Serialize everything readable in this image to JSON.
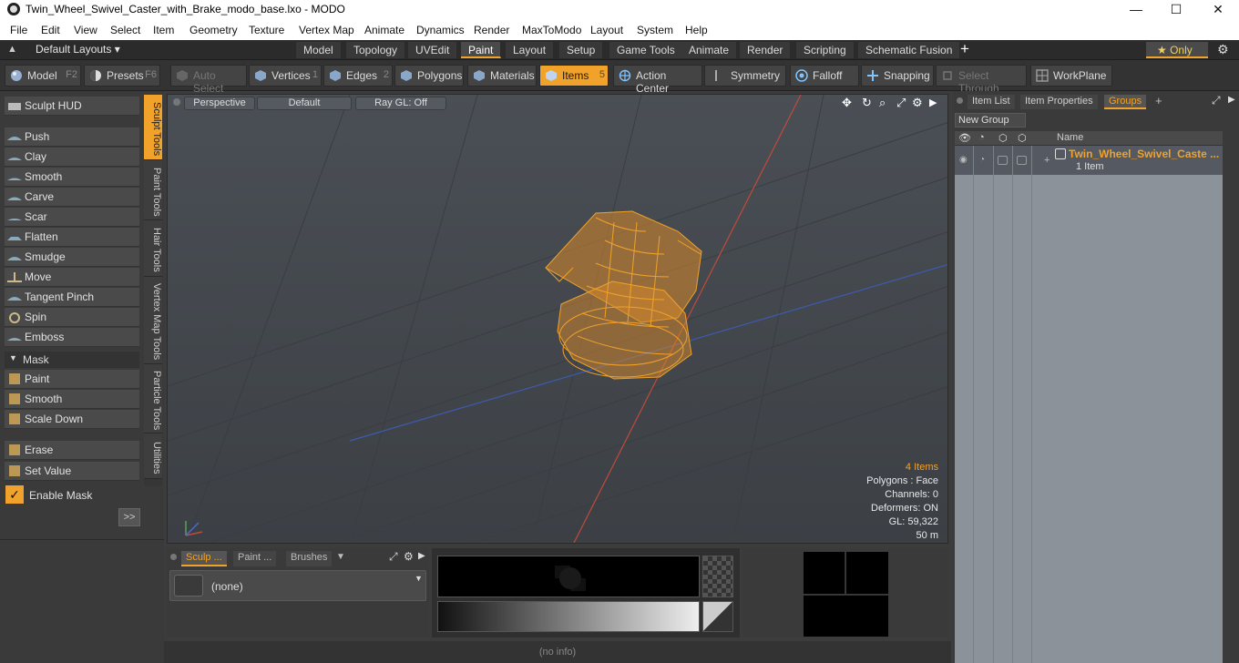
{
  "window": {
    "title": "Twin_Wheel_Swivel_Caster_with_Brake_modo_base.lxo - MODO",
    "minimize": "—",
    "maximize": "☐",
    "close": "✕"
  },
  "menu": [
    "File",
    "Edit",
    "View",
    "Select",
    "Item",
    "Geometry",
    "Texture",
    "Vertex Map",
    "Animate",
    "Dynamics",
    "Render",
    "MaxToModo",
    "Layout",
    "System",
    "Help"
  ],
  "layoutbar": {
    "layouts_label": "Default Layouts ▾",
    "tabs": [
      "Model",
      "Topology",
      "UVEdit",
      "Paint",
      "Layout",
      "Setup",
      "Game Tools",
      "Animate",
      "Render",
      "Scripting",
      "Schematic Fusion"
    ],
    "active_tab": "Paint",
    "add": "+",
    "only_label": "★  Only",
    "gear": "⚙"
  },
  "toolbar": {
    "model": "Model",
    "model_key": "F2",
    "presets": "Presets",
    "presets_key": "F6",
    "auto_select": "Auto Select",
    "vertices": "Vertices",
    "vertices_key": "1",
    "edges": "Edges",
    "edges_key": "2",
    "polygons": "Polygons",
    "materials": "Materials",
    "items": "Items",
    "items_key": "5",
    "action_center": "Action Center",
    "symmetry": "Symmetry",
    "falloff": "Falloff",
    "snapping": "Snapping",
    "select_through": "Select Through",
    "workplane": "WorkPlane"
  },
  "left": {
    "sculpt_hud": "Sculpt HUD",
    "tools": [
      "Push",
      "Clay",
      "Smooth",
      "Carve",
      "Scar",
      "Flatten",
      "Smudge",
      "Move",
      "Tangent Pinch",
      "Spin",
      "Emboss"
    ],
    "mask_header": "Mask",
    "mask_tools": [
      "Paint",
      "Smooth",
      "Scale Down"
    ],
    "erase": "Erase",
    "set_value": "Set Value",
    "enable_mask": "Enable Mask",
    "more": ">>",
    "vtabs": [
      "Sculpt Tools",
      "Paint Tools",
      "Hair Tools",
      "Vertex Map Tools",
      "Particle Tools",
      "Utilities"
    ]
  },
  "viewport": {
    "perspective": "Perspective",
    "default": "Default",
    "raygl": "Ray GL: Off",
    "info": [
      "4 Items",
      "Polygons : Face",
      "Channels: 0",
      "Deformers: ON",
      "GL: 59,322",
      "50 m"
    ],
    "colors": {
      "wire": "#f0a22a",
      "bg": "#454a50"
    }
  },
  "bottom": {
    "tabs": [
      "Sculp ...",
      "Paint ...",
      "Brushes"
    ],
    "preset_value": "(none)",
    "status": "(no info)"
  },
  "right": {
    "tabs": [
      "Item List",
      "Item Properties",
      "Groups"
    ],
    "active_tab": "Groups",
    "add": "+",
    "new_group": "New Group",
    "col_name": "Name",
    "group_name": "Twin_Wheel_Swivel_Caste ...",
    "group_count": "1 Item"
  }
}
